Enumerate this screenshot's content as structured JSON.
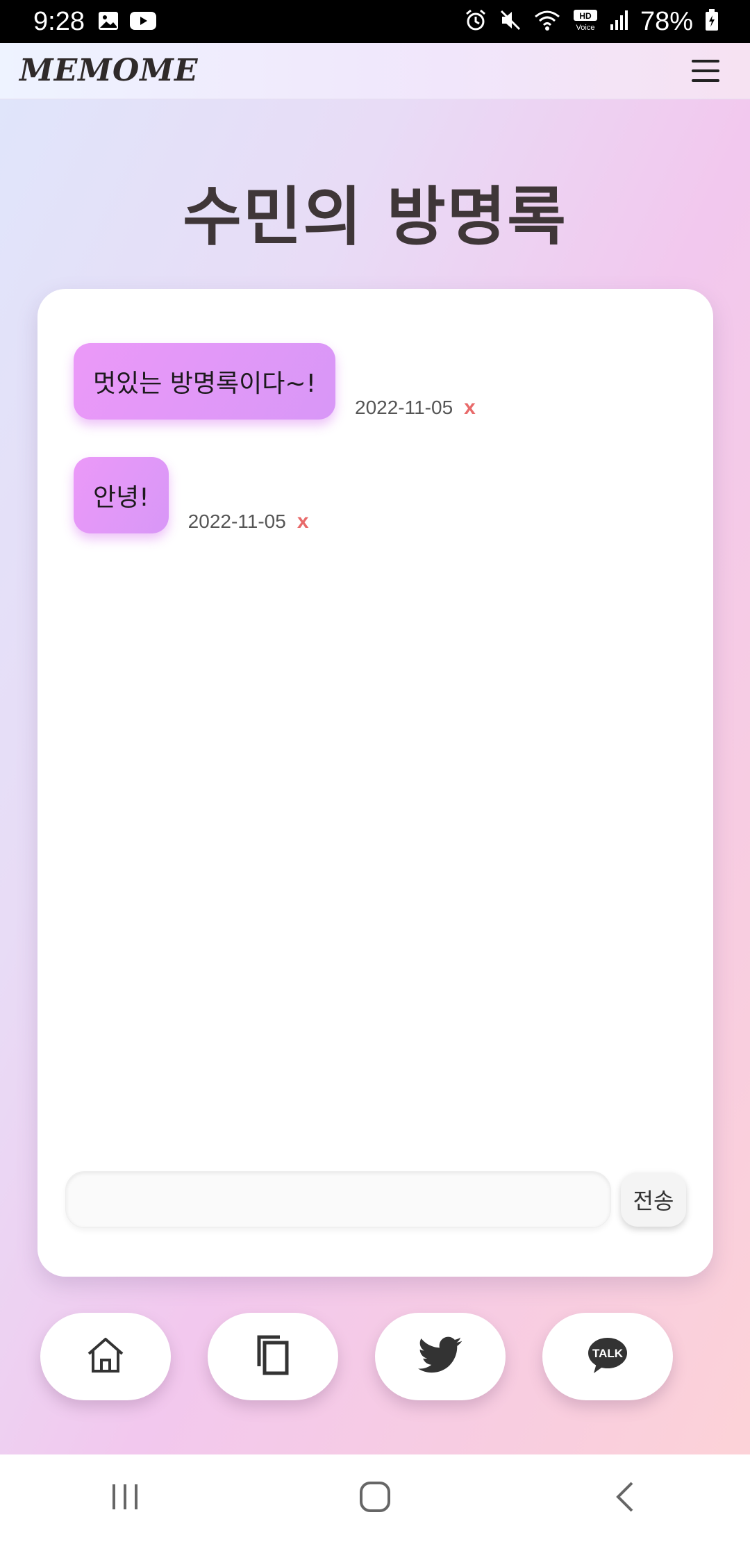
{
  "status_bar": {
    "time": "9:28",
    "battery": "78%",
    "left_icons": [
      "gallery-icon",
      "youtube-icon"
    ],
    "right_icons": [
      "alarm-icon",
      "mute-icon",
      "wifi-icon",
      "hd-voice-icon",
      "signal-icon",
      "battery-icon"
    ]
  },
  "header": {
    "brand": "MEMOME",
    "menu_icon": "hamburger-menu-icon"
  },
  "page": {
    "title": "수민의 방명록"
  },
  "messages": [
    {
      "text": "멋있는 방명록이다~!",
      "date": "2022-11-05",
      "delete_label": "x"
    },
    {
      "text": "안녕!",
      "date": "2022-11-05",
      "delete_label": "x"
    }
  ],
  "composer": {
    "placeholder": "",
    "value": "",
    "send_label": "전송"
  },
  "actions": [
    {
      "name": "home",
      "icon": "home-icon"
    },
    {
      "name": "copy",
      "icon": "copy-icon"
    },
    {
      "name": "twitter",
      "icon": "twitter-icon"
    },
    {
      "name": "kakaotalk",
      "icon": "kakaotalk-icon",
      "icon_text": "TALK"
    }
  ],
  "nav": [
    "recent-apps-icon",
    "home-nav-icon",
    "back-icon"
  ],
  "colors": {
    "bubble": "#e497f8",
    "delete": "#e86a6a",
    "title": "#3f3638"
  }
}
